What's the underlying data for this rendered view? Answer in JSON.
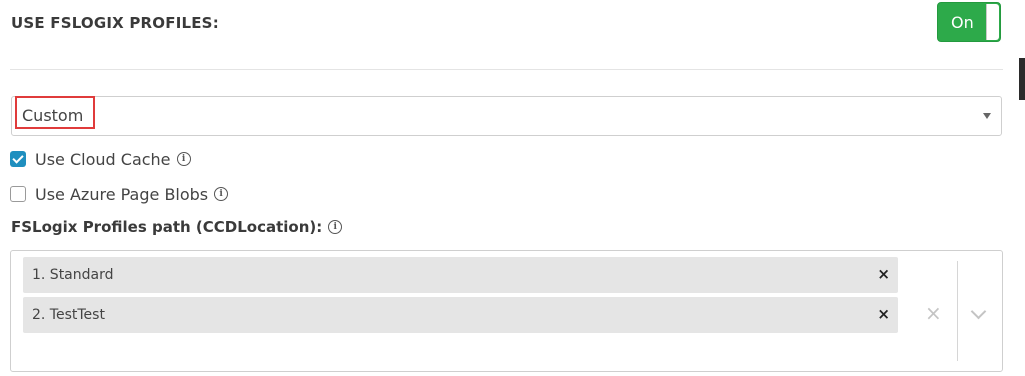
{
  "header": {
    "title": "USE FSLOGIX PROFILES:"
  },
  "toggle": {
    "label": "On",
    "state": "on",
    "color": "#2daa4a"
  },
  "select": {
    "value": "Custom"
  },
  "options": {
    "cloud_cache": {
      "label": "Use Cloud Cache",
      "checked": true
    },
    "page_blobs": {
      "label": "Use Azure Page Blobs",
      "checked": false
    }
  },
  "profiles_path": {
    "label": "FSLogix Profiles path (CCDLocation):",
    "items": [
      {
        "label": "1. Standard"
      },
      {
        "label": "2. TestTest"
      }
    ]
  },
  "colors": {
    "accent": "#1f8fbf",
    "highlight": "#e03b3b"
  }
}
